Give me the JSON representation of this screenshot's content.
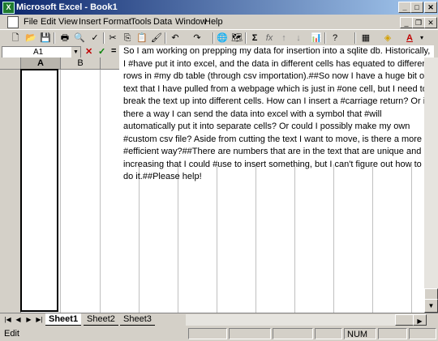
{
  "window": {
    "title": "Microsoft Excel - Book1"
  },
  "menu": [
    "File",
    "Edit",
    "View",
    "Insert",
    "Format",
    "Tools",
    "Data",
    "Window",
    "Help"
  ],
  "toolbar": {
    "sum": "Σ",
    "fx": "fx",
    "zoom_dd": "▾",
    "font_color_letter": "A"
  },
  "formula_bar": {
    "name_box": "A1",
    "cancel": "✕",
    "enter": "✓",
    "equals": "="
  },
  "columns": [
    "A",
    "B"
  ],
  "comment_text": "So I am working on prepping my data for insertion into a sqlite db. Historically, I #have put it into excel, and the data in different cells has equated to different rows in #my db table (through csv importation).##So now I have a huge bit of text that I have pulled from a webpage which is just in #one cell, but I need to break the text up into different cells. How can I insert a #carriage return? Or is there a way I can send the data into excel with a symbol that #will automatically put it into separate cells? Or could I possibly make my own #custom csv file? Aside from cutting the text I want to move, is there a more #efficient way?##There are numbers that are in the text that are unique and increasing that I could #use to insert something, but I can't figure out how to do it.##Please help!",
  "sheet_tabs": [
    "Sheet1",
    "Sheet2",
    "Sheet3"
  ],
  "status": {
    "mode": "Edit",
    "num": "NUM"
  }
}
